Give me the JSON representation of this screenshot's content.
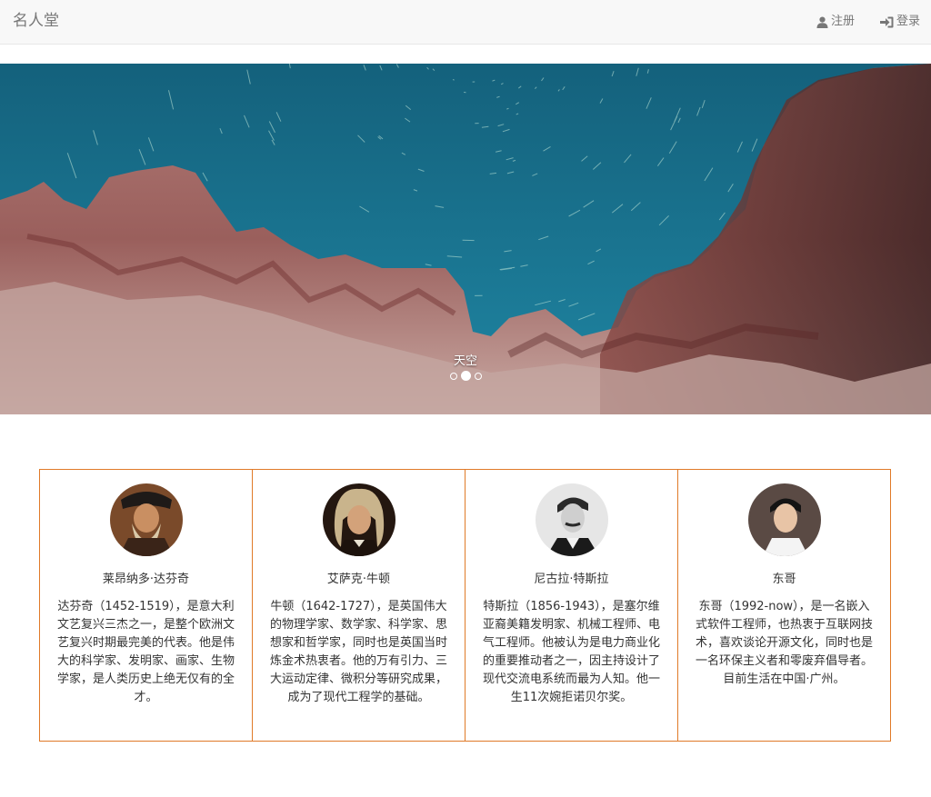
{
  "navbar": {
    "brand": "名人堂",
    "register_label": "注册",
    "login_label": "登录",
    "register_icon": "user-icon",
    "login_icon": "login-icon"
  },
  "carousel": {
    "caption": "天空",
    "indicators": 3,
    "active_index": 1
  },
  "people": [
    {
      "name": "莱昂纳多·达芬奇",
      "desc": "达芬奇（1452-1519），是意大利文艺复兴三杰之一，是整个欧洲文艺复兴时期最完美的代表。他是伟大的科学家、发明家、画家、生物学家，是人类历史上绝无仅有的全才。"
    },
    {
      "name": "艾萨克·牛顿",
      "desc": "牛顿（1642-1727），是英国伟大的物理学家、数学家、科学家、思想家和哲学家，同时也是英国当时炼金术热衷者。他的万有引力、三大运动定律、微积分等研究成果，成为了现代工程学的基础。"
    },
    {
      "name": "尼古拉·特斯拉",
      "desc": "特斯拉（1856-1943），是塞尔维亚裔美籍发明家、机械工程师、电气工程师。他被认为是电力商业化的重要推动者之一，因主持设计了现代交流电系统而最为人知。他一生11次婉拒诺贝尔奖。"
    },
    {
      "name": "东哥",
      "desc": "东哥（1992-now），是一名嵌入式软件工程师，也热衷于互联网技术，喜欢谈论开源文化，同时也是一名环保主义者和零废弃倡导者。目前生活在中国·广州。"
    }
  ],
  "colors": {
    "card_border": "#e07a28",
    "navbar_bg": "#f8f8f8",
    "sky": "#1c6f8c"
  }
}
